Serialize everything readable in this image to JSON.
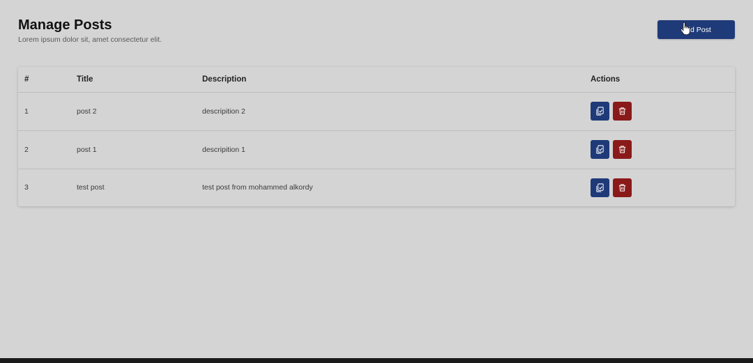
{
  "header": {
    "title": "Manage Posts",
    "subtitle": "Lorem ipsum dolor sit, amet consectetur elit."
  },
  "add_button": {
    "label": "Add Post"
  },
  "table": {
    "columns": [
      "#",
      "Title",
      "Description",
      "Actions"
    ],
    "rows": [
      {
        "num": "1",
        "title": "post 2",
        "description": "descripition 2"
      },
      {
        "num": "2",
        "title": "post 1",
        "description": "descripition 1"
      },
      {
        "num": "3",
        "title": "test post",
        "description": "test post from mohammed alkordy"
      }
    ]
  },
  "icons": {
    "edit": "copy-edit-icon",
    "delete": "trash-icon",
    "cursor": "hand-pointer-icon"
  },
  "colors": {
    "primary": "#1f3a78",
    "danger": "#8a1a1a",
    "background": "#d4d4d4"
  }
}
